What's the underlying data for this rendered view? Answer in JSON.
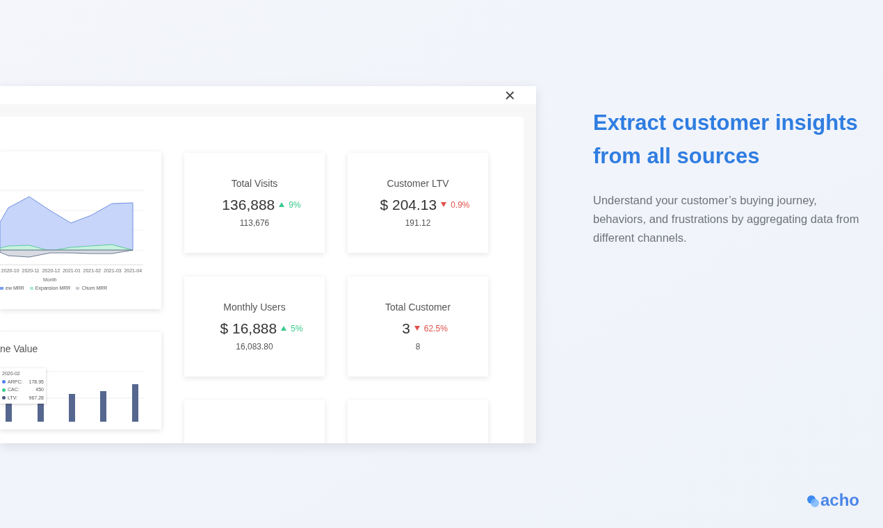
{
  "window": {
    "close_label": "×"
  },
  "area_chart": {
    "x_labels": [
      "2020-10",
      "2020-11",
      "2020-12",
      "2021-01",
      "2021-02",
      "2021-03",
      "2021-04"
    ],
    "x_title": "Month",
    "legend": [
      {
        "label": "ew MRR",
        "color": "#7aa0f0"
      },
      {
        "label": "Expansion MRR",
        "color": "#a8ecd0"
      },
      {
        "label": "Churn MRR",
        "color": "#c8ccd4"
      }
    ]
  },
  "bar_chart": {
    "title": "ne Value",
    "tooltip": {
      "title": "2020-02",
      "rows": [
        {
          "label": "ARPC:",
          "value": "178.95",
          "color": "#4f7ff0"
        },
        {
          "label": "CAC:",
          "value": "450",
          "color": "#3cc98f"
        },
        {
          "label": "LTV:",
          "value": "967.28",
          "color": "#4a5a80"
        }
      ]
    }
  },
  "kpis": [
    {
      "label": "Total Visits",
      "value": "136,888",
      "change": "9%",
      "rising": true,
      "previous": "113,676"
    },
    {
      "label": "Customer LTV",
      "value": "$ 204.13",
      "change": "0.9%",
      "rising": false,
      "previous": "191.12"
    },
    {
      "label": "Monthly Users",
      "value": "$ 16,888",
      "change": "5%",
      "rising": true,
      "previous": "16,083.80"
    },
    {
      "label": "Total Customer",
      "value": "3",
      "change": "62.5%",
      "rising": false,
      "previous": "8"
    }
  ],
  "empty_cards": [
    {
      "kind": "blank"
    },
    {
      "kind": "blank"
    }
  ],
  "headline": "Extract customer insights from all sources",
  "description": "Understand your customer’s buying journey, behaviors, and frustrations by aggregating data from different channels.",
  "logo": "acho"
}
